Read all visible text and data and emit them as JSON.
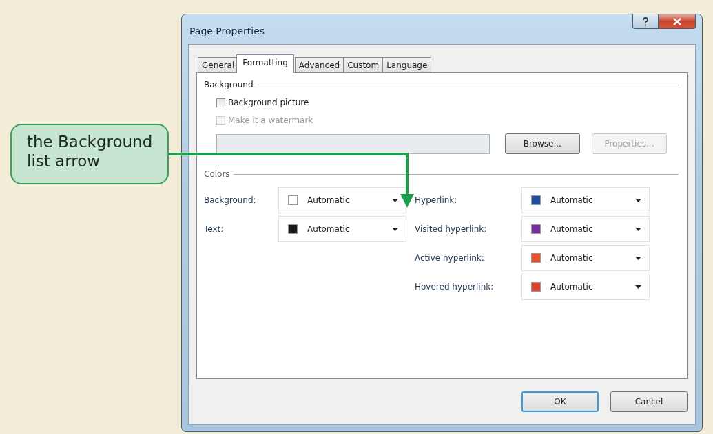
{
  "window": {
    "title": "Page Properties"
  },
  "tabs": [
    {
      "label": "General",
      "selected": false
    },
    {
      "label": "Formatting",
      "selected": true
    },
    {
      "label": "Advanced",
      "selected": false
    },
    {
      "label": "Custom",
      "selected": false
    },
    {
      "label": "Language",
      "selected": false
    }
  ],
  "background_group": {
    "title": "Background",
    "checkboxes": [
      {
        "label": "Background picture",
        "checked": false,
        "disabled": false
      },
      {
        "label": "Make it a watermark",
        "checked": false,
        "disabled": true
      }
    ],
    "picture_field": {
      "disabled": true
    },
    "buttons": [
      {
        "label": "Browse...",
        "disabled": false
      },
      {
        "label": "Properties...",
        "disabled": true
      }
    ]
  },
  "colors_group": {
    "title": "Colors",
    "left": [
      {
        "label": "Background:",
        "value": "Automatic",
        "color": "#ffffff"
      },
      {
        "label": "Text:",
        "value": "Automatic",
        "color": "#1a1a1a"
      }
    ],
    "right": [
      {
        "label": "Hyperlink:",
        "value": "Automatic",
        "color": "#1f4e9a"
      },
      {
        "label": "Visited hyperlink:",
        "value": "Automatic",
        "color": "#7b2ea0"
      },
      {
        "label": "Active hyperlink:",
        "value": "Automatic",
        "color": "#e4542a"
      },
      {
        "label": "Hovered hyperlink:",
        "value": "Automatic",
        "color": "#d9422f"
      }
    ]
  },
  "footer_buttons": [
    {
      "label": "OK",
      "default": true
    },
    {
      "label": "Cancel",
      "default": false
    }
  ],
  "callout": {
    "text": "the Background list arrow"
  }
}
